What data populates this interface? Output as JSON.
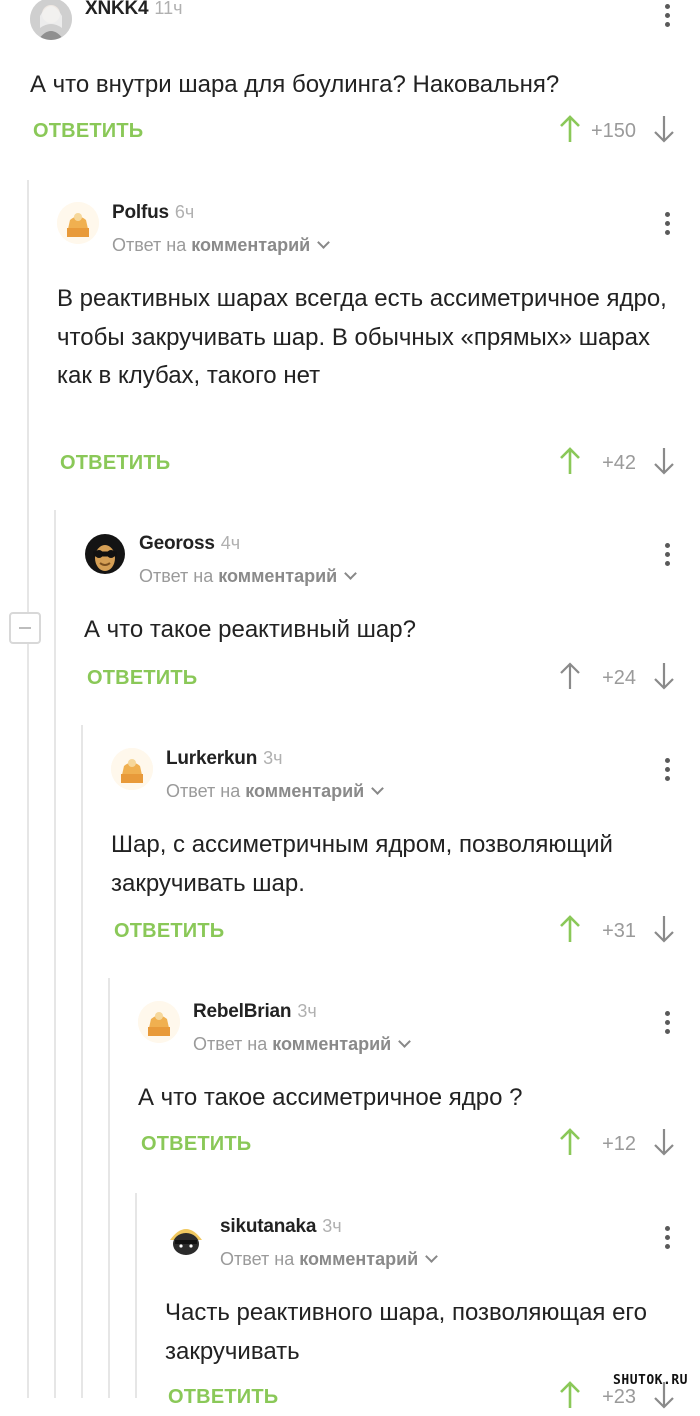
{
  "common": {
    "reply_label": "ОТВЕТИТЬ",
    "reply_to_prefix": "Ответ на",
    "reply_to_target": "комментарий"
  },
  "comments": [
    {
      "user": "XNKK4",
      "time": "11ч",
      "text": "А что внутри шара для боулинга? Наковальня?",
      "score": "+150",
      "vote": "up"
    },
    {
      "user": "Polfus",
      "time": "6ч",
      "text": "В реактивных шарах всегда есть ассиметричное ядро, чтобы закручивать шар. В обычных «прямых» шарах как в клубах, такого нет",
      "score": "+42",
      "vote": "up"
    },
    {
      "user": "Geoross",
      "time": "4ч",
      "text": "А что такое реактивный шар?",
      "score": "+24",
      "vote": "none"
    },
    {
      "user": "Lurkerkun",
      "time": "3ч",
      "text": "Шар, с ассиметричным ядром, позволяющий закручивать шар.",
      "score": "+31",
      "vote": "up"
    },
    {
      "user": "RebelBrian",
      "time": "3ч",
      "text": "А что такое ассиметричное ядро ?",
      "score": "+12",
      "vote": "up"
    },
    {
      "user": "sikutanaka",
      "time": "3ч",
      "text": "Часть реактивного шара, позволяющая его закручивать",
      "score": "+23",
      "vote": "up"
    }
  ],
  "colors": {
    "accent": "#8ac858",
    "muted": "#9a9a9a",
    "thread": "#e6e6e6"
  },
  "watermark": "SHUTOK.RU"
}
